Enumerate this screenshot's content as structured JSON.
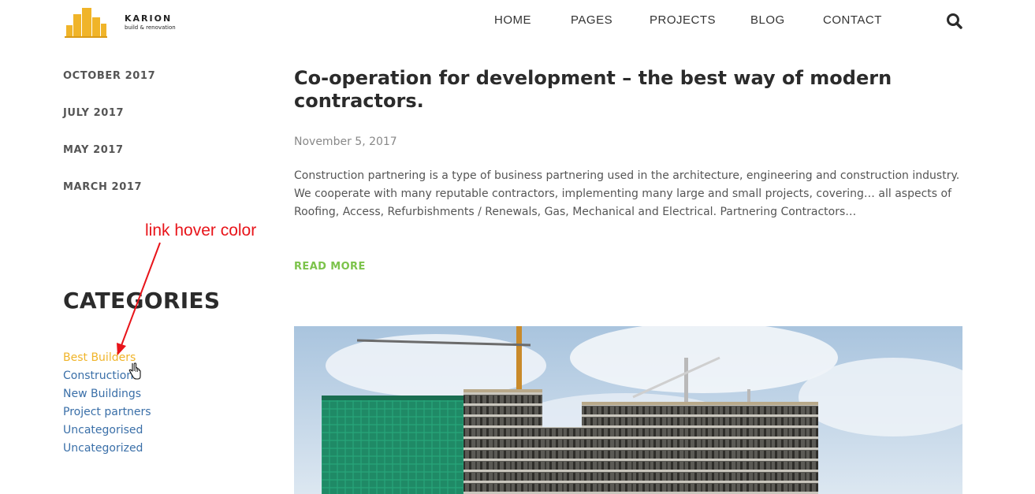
{
  "brand": {
    "name": "KARION",
    "tagline": "build & renovation",
    "logo_color": "#f0b429"
  },
  "nav": {
    "items": [
      "HOME",
      "PAGES",
      "PROJECTS",
      "BLOG",
      "CONTACT"
    ],
    "search_icon": "search-icon"
  },
  "sidebar": {
    "archives": [
      "OCTOBER 2017",
      "JULY 2017",
      "MAY 2017",
      "MARCH 2017"
    ],
    "categories_title": "CATEGORIES",
    "categories": [
      "Best Builders",
      "Construction",
      "New Buildings",
      "Project partners",
      "Uncategorised",
      "Uncategorized"
    ],
    "hovered_category_index": 0
  },
  "annotation": {
    "text": "link hover color",
    "color": "#e8141a"
  },
  "post": {
    "title": "Co-operation for development – the best way of modern contractors.",
    "date": "November 5, 2017",
    "excerpt": "Construction partnering is a type of business partnering used in the architecture, engineering and construction industry. We cooperate with many reputable contractors, implementing many large and small projects, covering… all aspects of Roofing, Access, Refurbishments / Renewals, Gas, Mechanical and Electrical. Partnering Contractors…",
    "read_more": "READ MORE",
    "image_icon": "construction-site-photo"
  },
  "colors": {
    "link": "#3a6fa8",
    "link_hover": "#f0b429",
    "read_more": "#7cc34b"
  }
}
